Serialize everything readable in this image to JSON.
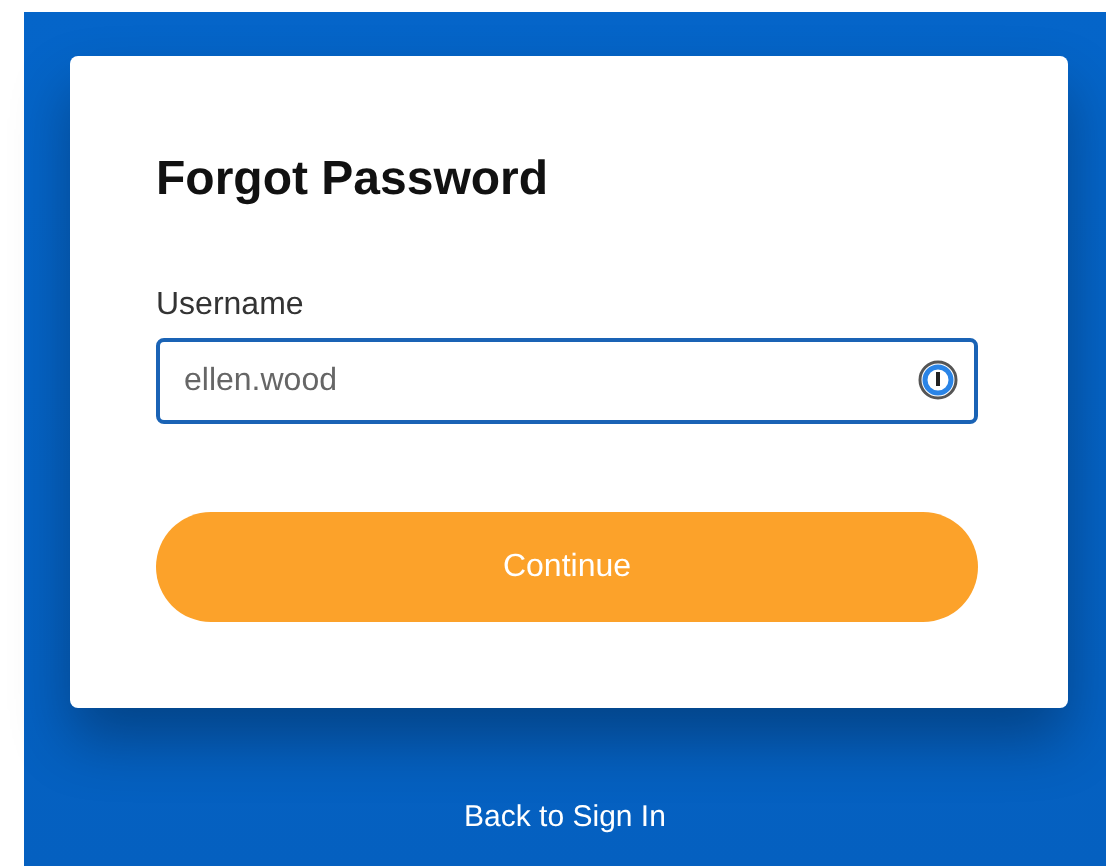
{
  "card": {
    "title": "Forgot Password",
    "username": {
      "label": "Username",
      "value": "ellen.wood"
    },
    "submit": "Continue"
  },
  "back_link": "Back to Sign In"
}
